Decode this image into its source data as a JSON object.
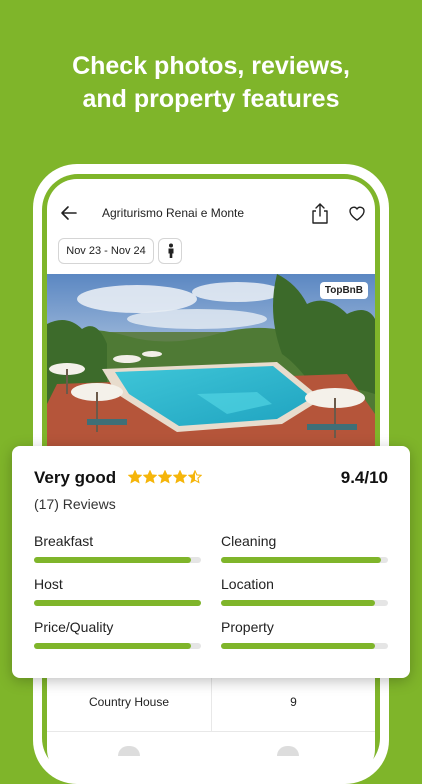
{
  "headline": {
    "line1": "Check photos, reviews,",
    "line2": "and property features"
  },
  "nav": {
    "title": "Agriturismo Renai e Monte",
    "icons": [
      "back-arrow-icon",
      "share-icon",
      "heart-icon"
    ]
  },
  "search": {
    "dates": "Nov 23 - Nov 24",
    "guests_icon": "person-icon"
  },
  "photo": {
    "badge": "TopBnB"
  },
  "rating": {
    "verdict": "Very good",
    "stars": 4.5,
    "score": "9.4/10",
    "reviews": "(17) Reviews",
    "criteria": [
      {
        "label": "Breakfast",
        "value": 0.94
      },
      {
        "label": "Cleaning",
        "value": 0.96
      },
      {
        "label": "Host",
        "value": 1.0
      },
      {
        "label": "Location",
        "value": 0.92
      },
      {
        "label": "Price/Quality",
        "value": 0.94
      },
      {
        "label": "Property",
        "value": 0.92
      }
    ]
  },
  "details": {
    "type": "Country House",
    "value": "9"
  },
  "colors": {
    "brand_green": "#7fb52a",
    "star": "#f5b50a"
  }
}
